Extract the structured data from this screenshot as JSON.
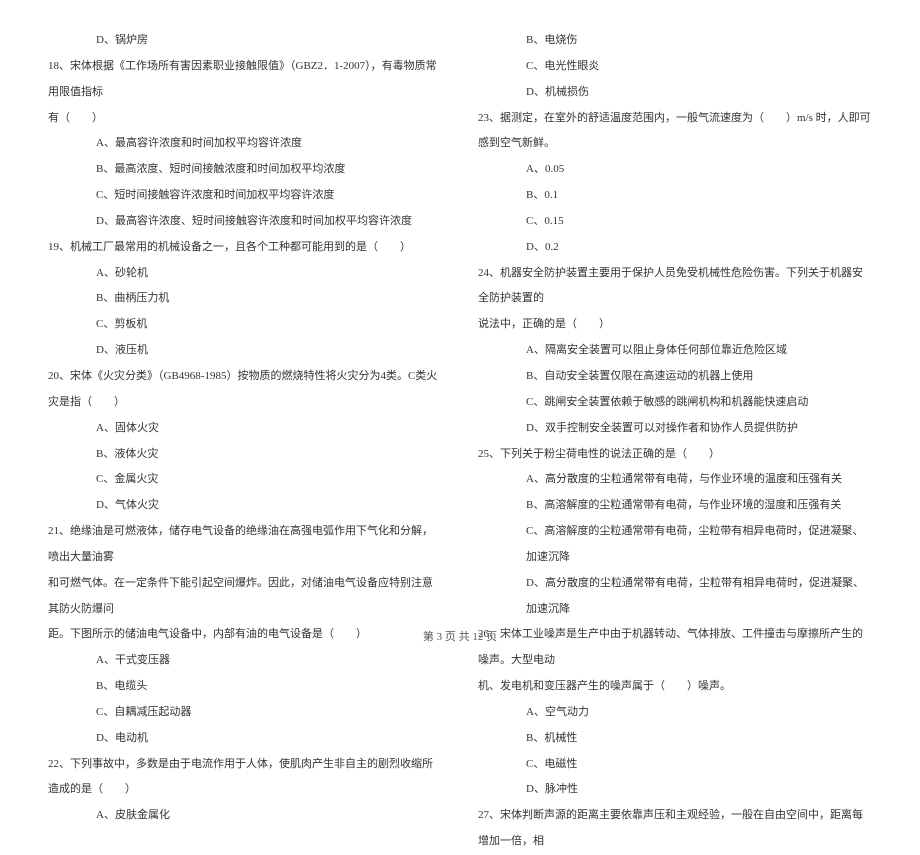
{
  "left": {
    "l0": "D、锅炉房",
    "l1": "18、宋体根据《工作场所有害因素职业接触限值》（GBZ2．1-2007），有毒物质常用限值指标",
    "l2": "有（　　）",
    "l3": "A、最高容许浓度和时间加权平均容许浓度",
    "l4": "B、最高浓度、短时间接触浓度和时间加权平均浓度",
    "l5": "C、短时间接触容许浓度和时间加权平均容许浓度",
    "l6": "D、最高容许浓度、短时间接触容许浓度和时间加权平均容许浓度",
    "l7": "19、机械工厂最常用的机械设备之一，且各个工种都可能用到的是（　　）",
    "l8": "A、砂轮机",
    "l9": "B、曲柄压力机",
    "l10": "C、剪板机",
    "l11": "D、液压机",
    "l12": "20、宋体《火灾分类》（GB4968-1985）按物质的燃烧特性将火灾分为4类。C类火灾是指（　　）",
    "l13": "A、固体火灾",
    "l14": "B、液体火灾",
    "l15": "C、金属火灾",
    "l16": "D、气体火灾",
    "l17": "21、绝缘油是可燃液体，储存电气设备的绝缘油在高强电弧作用下气化和分解，喷出大量油雾",
    "l18": "和可燃气体。在一定条件下能引起空间爆炸。因此，对储油电气设备应特别注意其防火防爆问",
    "l19": "距。下图所示的储油电气设备中，内部有油的电气设备是（　　）",
    "l20": "A、干式变压器",
    "l21": "B、电缆头",
    "l22": "C、自耦减压起动器",
    "l23": "D、电动机",
    "l24": "22、下列事故中，多数是由于电流作用于人体，使肌肉产生非自主的剧烈收缩所造成的是（　　）",
    "l25": "A、皮肤金属化"
  },
  "right": {
    "r0": "B、电烧伤",
    "r1": "C、电光性眼炎",
    "r2": "D、机械损伤",
    "r3": "23、据测定，在室外的舒适温度范围内，一般气流速度为（　　）m/s 时，人即可感到空气新鲜。",
    "r4": "A、0.05",
    "r5": "B、0.1",
    "r6": "C、0.15",
    "r7": "D、0.2",
    "r8": "24、机器安全防护装置主要用于保护人员免受机械性危险伤害。下列关于机器安全防护装置的",
    "r9": "说法中，正确的是（　　）",
    "r10": "A、隔离安全装置可以阻止身体任何部位靠近危险区域",
    "r11": "B、自动安全装置仅限在高速运动的机器上使用",
    "r12": "C、跳闸安全装置依赖于敏感的跳闸机构和机器能快速启动",
    "r13": "D、双手控制安全装置可以对操作者和协作人员提供防护",
    "r14": "25、下列关于粉尘荷电性的说法正确的是（　　）",
    "r15": "A、高分散度的尘粒通常带有电荷，与作业环境的温度和压强有关",
    "r16": "B、高溶解度的尘粒通常带有电荷，与作业环境的湿度和压强有关",
    "r17": "C、高溶解度的尘粒通常带有电荷，尘粒带有相异电荷时，促进凝聚、加速沉降",
    "r18": "D、高分散度的尘粒通常带有电荷，尘粒带有相异电荷时，促进凝聚、加速沉降",
    "r19": "26、宋体工业噪声是生产中由于机器转动、气体排放、工件撞击与摩擦所产生的噪声。大型电动",
    "r20": "机、发电机和变压器产生的噪声属于（　　）噪声。",
    "r21": "A、空气动力",
    "r22": "B、机械性",
    "r23": "C、电磁性",
    "r24": "D、脉冲性",
    "r25": "27、宋体判断声源的距离主要依靠声压和主观经验，一般在自由空间中，距离每增加一倍，相"
  },
  "footer": "第 3 页 共 12 页"
}
